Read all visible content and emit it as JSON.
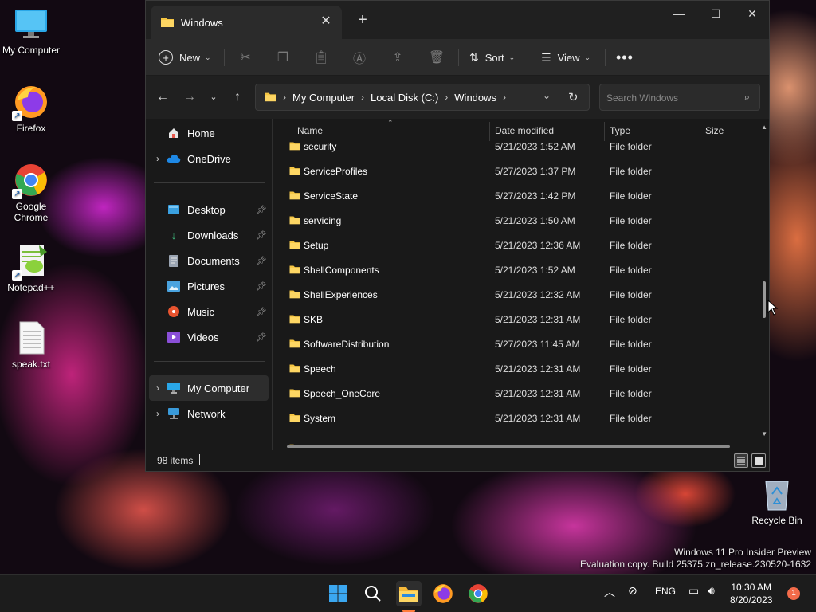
{
  "desktop": {
    "icons": [
      {
        "label": "My Computer"
      },
      {
        "label": "Firefox"
      },
      {
        "label": "Google Chrome"
      },
      {
        "label": "Notepad++"
      },
      {
        "label": "speak.txt"
      },
      {
        "label": "Recycle Bin"
      }
    ],
    "watermark": {
      "line1": "Windows 11 Pro Insider Preview",
      "line2": "Evaluation copy. Build 25375.zn_release.230520-1632"
    }
  },
  "window": {
    "tab_title": "Windows",
    "commands": {
      "new": "New",
      "sort": "Sort",
      "view": "View"
    },
    "breadcrumb": [
      "My Computer",
      "Local Disk (C:)",
      "Windows"
    ],
    "search_placeholder": "Search Windows",
    "nav": {
      "home": "Home",
      "onedrive": "OneDrive",
      "desktop": "Desktop",
      "downloads": "Downloads",
      "documents": "Documents",
      "pictures": "Pictures",
      "music": "Music",
      "videos": "Videos",
      "mycomputer": "My Computer",
      "network": "Network"
    },
    "columns": {
      "name": "Name",
      "date": "Date modified",
      "type": "Type",
      "size": "Size"
    },
    "files": [
      {
        "name": "security",
        "date": "5/21/2023 1:52 AM",
        "type": "File folder"
      },
      {
        "name": "ServiceProfiles",
        "date": "5/27/2023 1:37 PM",
        "type": "File folder"
      },
      {
        "name": "ServiceState",
        "date": "5/27/2023 1:42 PM",
        "type": "File folder"
      },
      {
        "name": "servicing",
        "date": "5/21/2023 1:50 AM",
        "type": "File folder"
      },
      {
        "name": "Setup",
        "date": "5/21/2023 12:36 AM",
        "type": "File folder"
      },
      {
        "name": "ShellComponents",
        "date": "5/21/2023 1:52 AM",
        "type": "File folder"
      },
      {
        "name": "ShellExperiences",
        "date": "5/21/2023 12:32 AM",
        "type": "File folder"
      },
      {
        "name": "SKB",
        "date": "5/21/2023 12:31 AM",
        "type": "File folder"
      },
      {
        "name": "SoftwareDistribution",
        "date": "5/27/2023 11:45 AM",
        "type": "File folder"
      },
      {
        "name": "Speech",
        "date": "5/21/2023 12:31 AM",
        "type": "File folder"
      },
      {
        "name": "Speech_OneCore",
        "date": "5/21/2023 12:31 AM",
        "type": "File folder"
      },
      {
        "name": "System",
        "date": "5/21/2023 12:31 AM",
        "type": "File folder"
      }
    ],
    "status": {
      "item_count": "98 items"
    }
  },
  "taskbar": {
    "language": "ENG",
    "time": "10:30 AM",
    "date": "8/20/2023",
    "notification_count": "1"
  },
  "colors": {
    "folder": "#f5c542",
    "accent": "#0078d4",
    "taskbar_active": "#ff7b3a"
  }
}
